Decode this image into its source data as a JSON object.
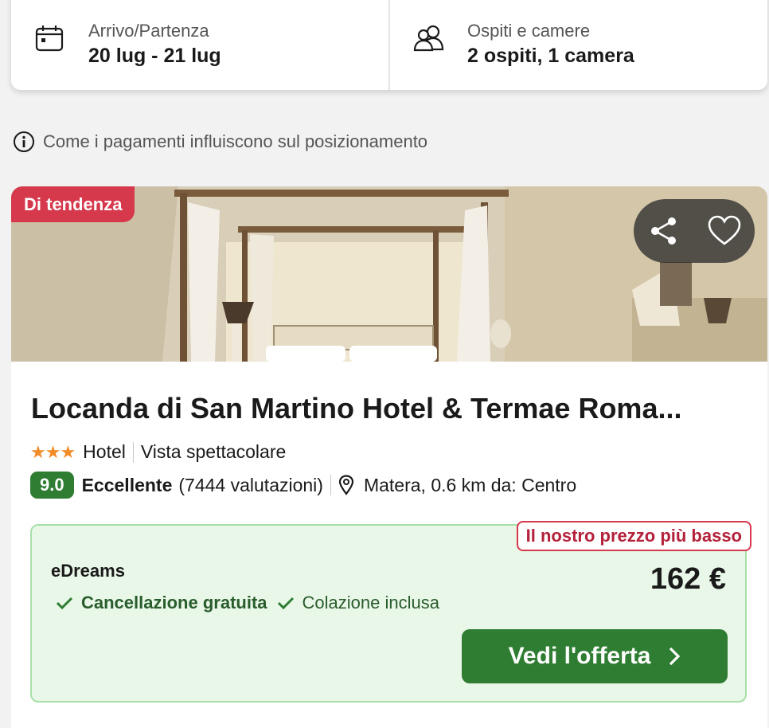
{
  "search": {
    "dates_label": "Arrivo/Partenza",
    "dates_value": "20 lug - 21 lug",
    "guests_label": "Ospiti e camere",
    "guests_value": "2 ospiti, 1 camera"
  },
  "info": {
    "text": "Come i pagamenti influiscono sul posizionamento"
  },
  "hotel": {
    "badge": "Di tendenza",
    "name": "Locanda di San Martino Hotel & Termae Roma...",
    "stars": "★★★",
    "type": "Hotel",
    "feature": "Vista spettacolare",
    "score": "9.0",
    "rating_label": "Eccellente",
    "reviews": "(7444 valutazioni)",
    "location": "Matera, 0.6 km da: Centro"
  },
  "offer": {
    "tag": "Il nostro prezzo più basso",
    "provider": "eDreams",
    "price": "162 €",
    "perk_1": "Cancellazione gratuita",
    "perk_2": "Colazione inclusa",
    "cta": "Vedi l'offerta"
  },
  "icons": {
    "calendar": "calendar-icon",
    "guests": "guests-icon",
    "info": "info-icon",
    "share": "share-icon",
    "heart": "heart-icon",
    "location": "location-pin-icon",
    "check": "check-icon",
    "chevron": "chevron-right-icon"
  },
  "colors": {
    "badge": "#d6384c",
    "score": "#2e7d32",
    "cta": "#2e7d32",
    "offer_bg": "#e9f7e9",
    "stars": "#f28c28"
  }
}
